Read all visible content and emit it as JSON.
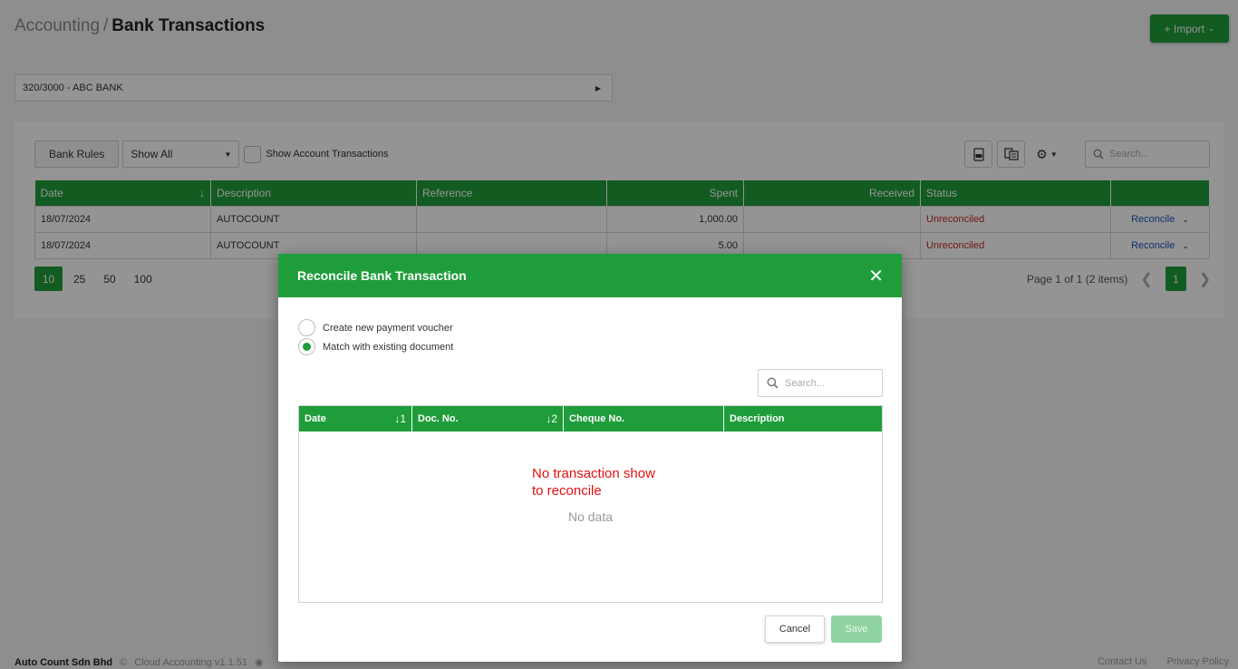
{
  "breadcrumb": {
    "parent": "Accounting",
    "separator": "/",
    "current": "Bank Transactions"
  },
  "import_button": {
    "label": "+ Import",
    "chevron": "chevron-down-icon"
  },
  "bank_account": {
    "selected": "320/3000 - ABC BANK"
  },
  "toolbar": {
    "bank_rules": "Bank Rules",
    "filter": "Show All",
    "show_account_transactions": "Show Account Transactions",
    "search_placeholder": "Search..."
  },
  "table": {
    "columns": [
      "Date",
      "Description",
      "Reference",
      "Spent",
      "Received",
      "Status"
    ],
    "sort_icon": "↓",
    "rows": [
      {
        "date": "18/07/2024",
        "description": "AUTOCOUNT",
        "reference": "",
        "spent": "1,000.00",
        "received": "",
        "status": "Unreconciled",
        "action": "Reconcile"
      },
      {
        "date": "18/07/2024",
        "description": "AUTOCOUNT",
        "reference": "",
        "spent": "5.00",
        "received": "",
        "status": "Unreconciled",
        "action": "Reconcile"
      }
    ]
  },
  "pager": {
    "sizes": [
      "10",
      "25",
      "50",
      "100"
    ],
    "active_size": "10",
    "info": "Page 1 of 1 (2 items)",
    "current_page": "1"
  },
  "footer": {
    "company": "Auto Count Sdn Bhd",
    "copyright": "©",
    "version": "Cloud Accounting v1.1.51",
    "contact": "Contact Us",
    "privacy": "Privacy Policy"
  },
  "modal": {
    "title": "Reconcile Bank Transaction",
    "option_new": "Create new payment voucher",
    "option_match": "Match with existing document",
    "selected_option": "match",
    "search_placeholder": "Search...",
    "columns": [
      {
        "label": "Date",
        "sort": "↓1"
      },
      {
        "label": "Doc. No.",
        "sort": "↓2"
      },
      {
        "label": "Cheque No.",
        "sort": ""
      },
      {
        "label": "Description",
        "sort": ""
      }
    ],
    "annotation_line1": "No transaction show",
    "annotation_line2": "to reconcile",
    "empty_text": "No data",
    "cancel": "Cancel",
    "save": "Save"
  },
  "colors": {
    "accent": "#1f9d3a",
    "status_unreconciled": "#c62828",
    "link": "#1a56b8"
  }
}
